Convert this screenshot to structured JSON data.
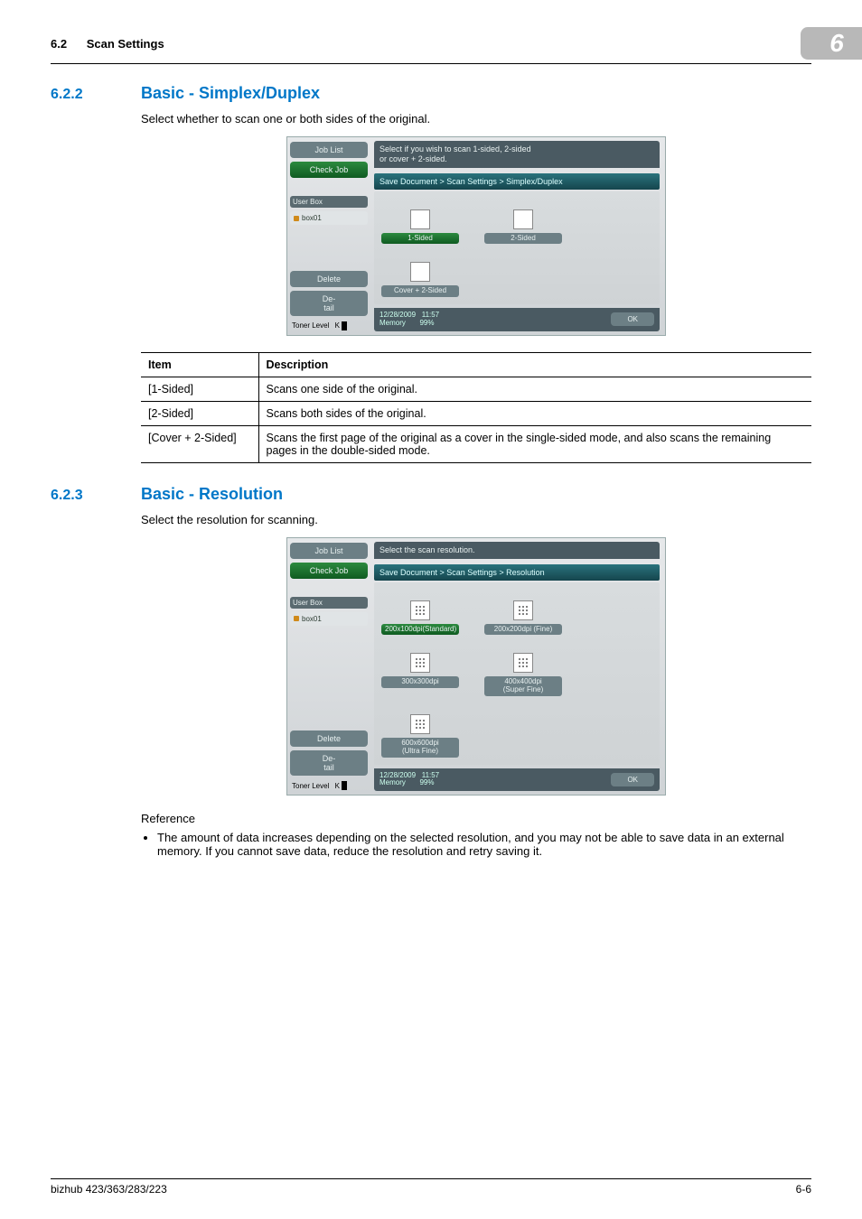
{
  "header": {
    "section_num": "6.2",
    "section_title": "Scan Settings",
    "chapter_num": "6"
  },
  "sec1": {
    "num": "6.2.2",
    "title": "Basic - Simplex/Duplex",
    "intro": "Select whether to scan one or both sides of the original."
  },
  "shot1": {
    "side": {
      "job_list": "Job List",
      "check_job": "Check Job",
      "user_box": "User Box",
      "box_item": "box01",
      "delete": "Delete",
      "detail": "De-\ntail",
      "toner": "Toner Level",
      "toner_k": "K"
    },
    "hint": "Select if you wish to scan 1-sided, 2-sided\nor cover + 2-sided.",
    "crumb": "Save Document > Scan Settings > Simplex/Duplex",
    "opts": [
      {
        "label": "1-Sided",
        "selected": true
      },
      {
        "label": "2-Sided",
        "selected": false
      },
      {
        "label": "Cover + 2-Sided",
        "selected": false
      }
    ],
    "datetime": "12/28/2009   11:57\nMemory       99%",
    "ok": "OK"
  },
  "table1": {
    "head_item": "Item",
    "head_desc": "Description",
    "rows": [
      {
        "item": "[1-Sided]",
        "desc": "Scans one side of the original."
      },
      {
        "item": "[2-Sided]",
        "desc": "Scans both sides of the original."
      },
      {
        "item": "[Cover + 2-Sided]",
        "desc": "Scans the first page of the original as a cover in the single-sided mode, and also scans the remaining pages in the double-sided mode."
      }
    ]
  },
  "sec2": {
    "num": "6.2.3",
    "title": "Basic - Resolution",
    "intro": "Select the resolution for scanning."
  },
  "shot2": {
    "hint": "Select the scan resolution.",
    "crumb": "Save Document > Scan Settings > Resolution",
    "opts": [
      {
        "label": "200x100dpi(Standard)",
        "selected": true
      },
      {
        "label": "200x200dpi (Fine)",
        "selected": false
      },
      {
        "label": "300x300dpi",
        "selected": false
      },
      {
        "label": "400x400dpi\n(Super Fine)",
        "selected": false
      },
      {
        "label": "600x600dpi\n(Ultra Fine)",
        "selected": false
      }
    ],
    "datetime": "12/28/2009   11:57\nMemory       99%",
    "ok": "OK"
  },
  "reference": {
    "label": "Reference",
    "bullet": "The amount of data increases depending on the selected resolution, and you may not be able to save data in an external memory. If you cannot save data, reduce the resolution and retry saving it."
  },
  "footer": {
    "left": "bizhub 423/363/283/223",
    "right": "6-6"
  }
}
